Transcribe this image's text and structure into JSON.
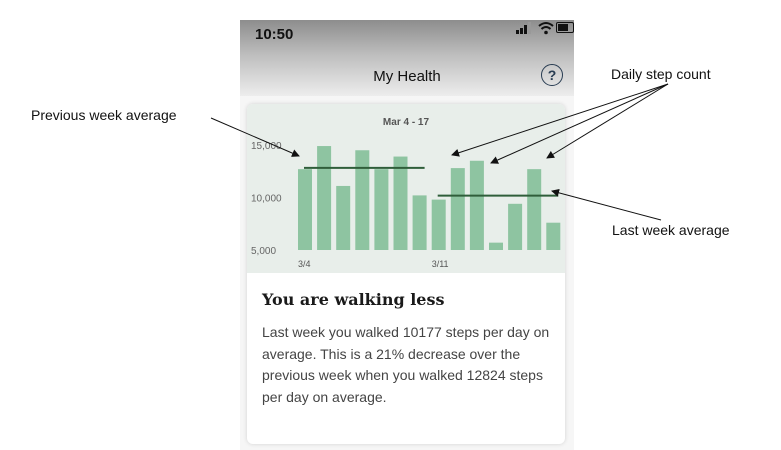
{
  "status_bar": {
    "time": "10:50"
  },
  "header": {
    "title": "My Health",
    "help_icon": "question-circle-icon"
  },
  "card": {
    "heading": "You are walking less",
    "body": "Last week you walked 10177 steps per day on average. This is a 21% decrease over the previous week when you walked 12824 steps per day on average."
  },
  "chart_data": {
    "type": "bar",
    "title": "Mar 4 - 17",
    "ylim": [
      5000,
      15000
    ],
    "yticks": [
      "15,000",
      "10,000",
      "5,000"
    ],
    "ytick_values": [
      15000,
      10000,
      5000
    ],
    "x_tick_labels": [
      {
        "index": 0,
        "label": "3/4"
      },
      {
        "index": 7,
        "label": "3/11"
      }
    ],
    "values": [
      12700,
      14900,
      11100,
      14500,
      12700,
      13900,
      10200,
      9800,
      12800,
      13500,
      5700,
      9400,
      12700,
      7600
    ],
    "bar_color": "#8ec4a1",
    "averages": [
      {
        "start": 0,
        "end": 6,
        "value": 12824
      },
      {
        "start": 7,
        "end": 13,
        "value": 10177
      }
    ],
    "average_line_color": "#2f5e3a",
    "grid": false
  },
  "annotations": {
    "previous_week_average": "Previous week average",
    "daily_step_count": "Daily step count",
    "last_week_average": "Last week average"
  },
  "colors": {
    "chart_background": "#e8eeea",
    "card_background": "#ffffff"
  }
}
